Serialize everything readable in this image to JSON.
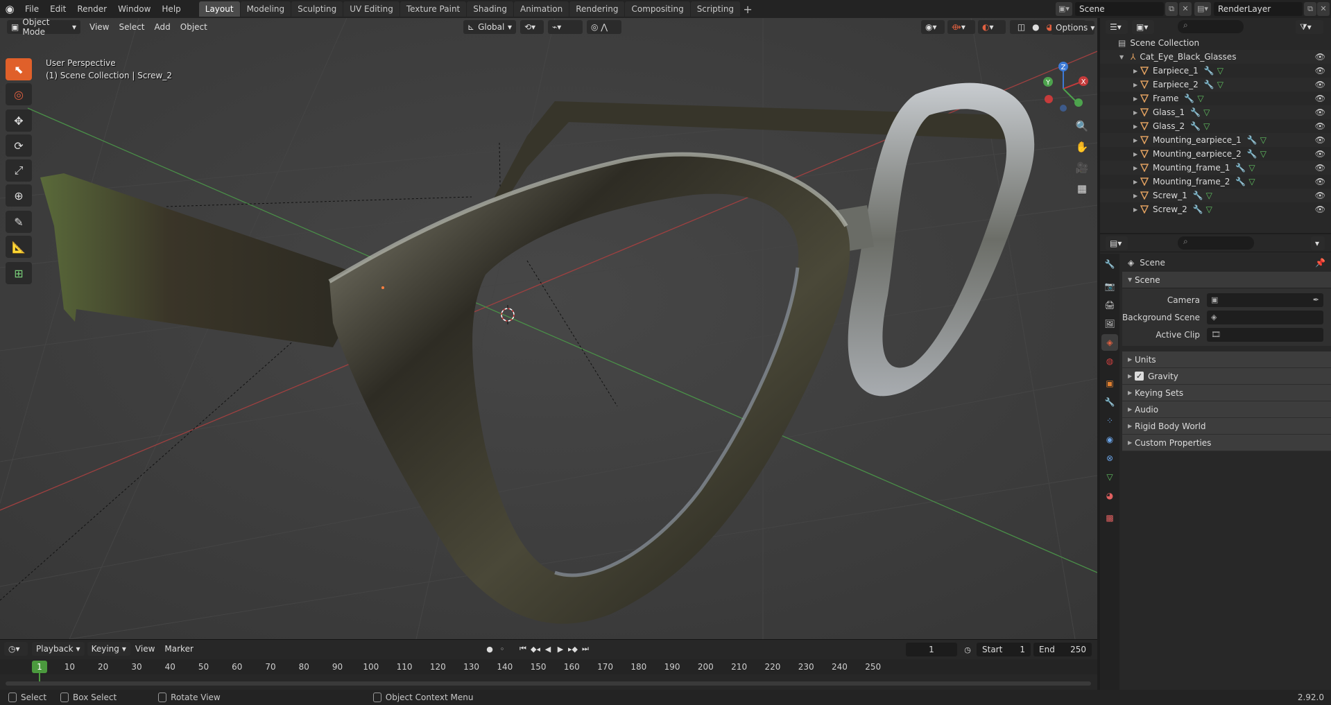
{
  "topbar": {
    "menu": [
      "File",
      "Edit",
      "Render",
      "Window",
      "Help"
    ],
    "workspaces": [
      {
        "label": "Layout",
        "active": true
      },
      {
        "label": "Modeling"
      },
      {
        "label": "Sculpting"
      },
      {
        "label": "UV Editing"
      },
      {
        "label": "Texture Paint"
      },
      {
        "label": "Shading"
      },
      {
        "label": "Animation"
      },
      {
        "label": "Rendering"
      },
      {
        "label": "Compositing"
      },
      {
        "label": "Scripting"
      }
    ],
    "add_workspace": "+",
    "scene_name": "Scene",
    "view_layer": "RenderLayer"
  },
  "viewport": {
    "mode": "Object Mode",
    "menu": [
      "View",
      "Select",
      "Add",
      "Object"
    ],
    "transform_orientation": "Global",
    "options_label": "Options",
    "overlay_line1": "User Perspective",
    "overlay_line2": "(1) Scene Collection | Screw_2",
    "gizmo_axes": {
      "x": "X",
      "y": "Y",
      "z": "Z"
    },
    "colors": {
      "x_axis": "#c63b3b",
      "y_axis": "#4da34d",
      "active_tool": "#e0602a"
    }
  },
  "timeline": {
    "menu": [
      "Playback",
      "Keying",
      "View",
      "Marker"
    ],
    "current_frame": "1",
    "start_label": "Start",
    "start_value": "1",
    "end_label": "End",
    "end_value": "250",
    "ticks": [
      "10",
      "20",
      "30",
      "40",
      "50",
      "60",
      "70",
      "80",
      "90",
      "100",
      "110",
      "120",
      "130",
      "140",
      "150",
      "160",
      "170",
      "180",
      "190",
      "200",
      "210",
      "220",
      "230",
      "240",
      "250"
    ],
    "frame_indicator": "1"
  },
  "statusbar": {
    "select": "Select",
    "box_select": "Box Select",
    "rotate_view": "Rotate View",
    "context_menu": "Object Context Menu",
    "version": "2.92.0"
  },
  "outliner": {
    "root": "Scene Collection",
    "collection": "Cat_Eye_Black_Glasses",
    "objects": [
      "Earpiece_1",
      "Earpiece_2",
      "Frame",
      "Glass_1",
      "Glass_2",
      "Mounting_earpiece_1",
      "Mounting_earpiece_2",
      "Mounting_frame_1",
      "Mounting_frame_2",
      "Screw_1",
      "Screw_2"
    ]
  },
  "properties": {
    "context": "Scene",
    "panel_title": "Scene",
    "camera_label": "Camera",
    "background_label": "Background Scene",
    "clip_label": "Active Clip",
    "subpanels": [
      "Units",
      "Gravity",
      "Keying Sets",
      "Audio",
      "Rigid Body World",
      "Custom Properties"
    ],
    "gravity_checked": true
  }
}
